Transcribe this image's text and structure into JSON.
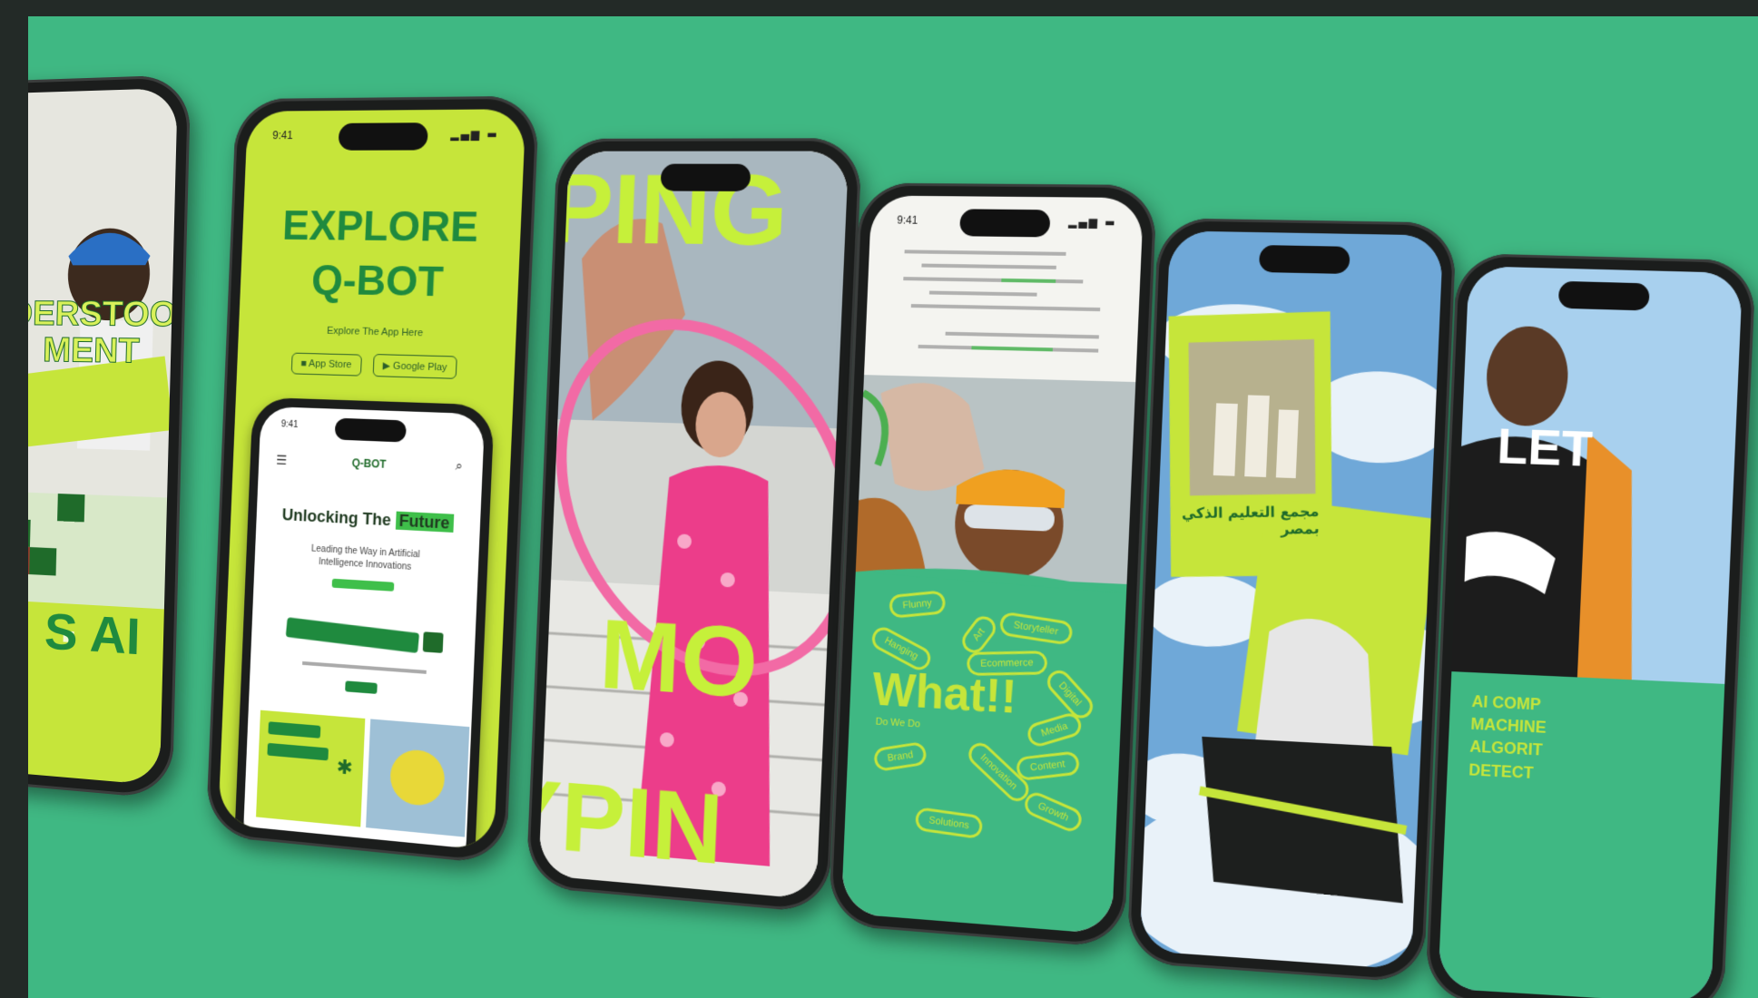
{
  "scene": {
    "background_color": "#3fb883",
    "border_color": "#232a27"
  },
  "phone1": {
    "line1": "DERSTOOD",
    "line2": "MENT",
    "bottom": "S AI"
  },
  "phone2": {
    "time": "9:41",
    "title_line1": "EXPLORE",
    "title_line2": "Q-BOT",
    "subtitle": "Explore The App Here",
    "app_store": "App Store",
    "google_play": "Google Play",
    "inner": {
      "time": "9:41",
      "logo": "Q-BOT",
      "heading_start": "Unlocking The",
      "heading_highlight": "Future",
      "body": "Leading the Way in Artificial Intelligence Innovations"
    }
  },
  "phone3": {
    "top_word": "PING",
    "mid_word": "MO",
    "bottom_word": "YPIN"
  },
  "phone4": {
    "time": "9:41",
    "headline": "What!!",
    "sub": "Do We Do",
    "pills": [
      "Flunny",
      "Art",
      "Storyteller",
      "Hanging",
      "Ecommerce",
      "Digital",
      "Media",
      "Brand",
      "Innovation",
      "Content",
      "Growth",
      "Solutions"
    ]
  },
  "phone5": {
    "poster_text": "مجمع التعليم الذكي بمصر"
  },
  "phone6": {
    "overlay_word": "LET",
    "text_lines": [
      "AI COMP",
      "MACHINE",
      "ALGORIT",
      "DETECT"
    ]
  }
}
